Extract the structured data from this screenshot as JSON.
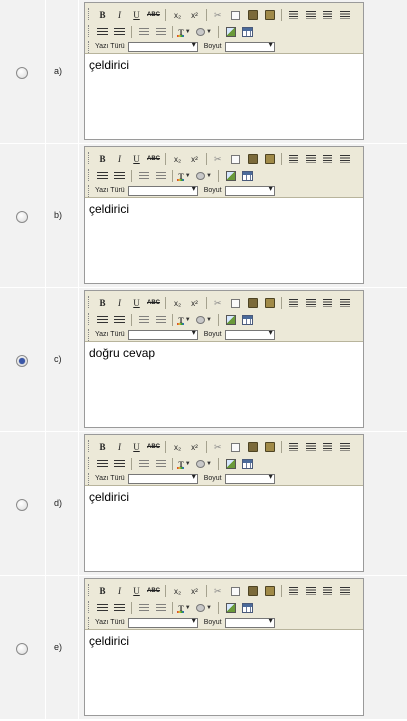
{
  "toolbar": {
    "row1": [
      "B",
      "I",
      "U",
      "ABC"
    ],
    "sub_label": "x₂",
    "sup_label": "x²",
    "font_label": "Yazı Türü",
    "size_label": "Boyut",
    "text_color_label": "T"
  },
  "options": [
    {
      "letter": "a)",
      "text": "çeldirici",
      "checked": false
    },
    {
      "letter": "b)",
      "text": "çeldirici",
      "checked": false
    },
    {
      "letter": "c)",
      "text": "doğru cevap",
      "checked": true
    },
    {
      "letter": "d)",
      "text": "çeldirici",
      "checked": false
    },
    {
      "letter": "e)",
      "text": "çeldirici",
      "checked": false
    }
  ]
}
